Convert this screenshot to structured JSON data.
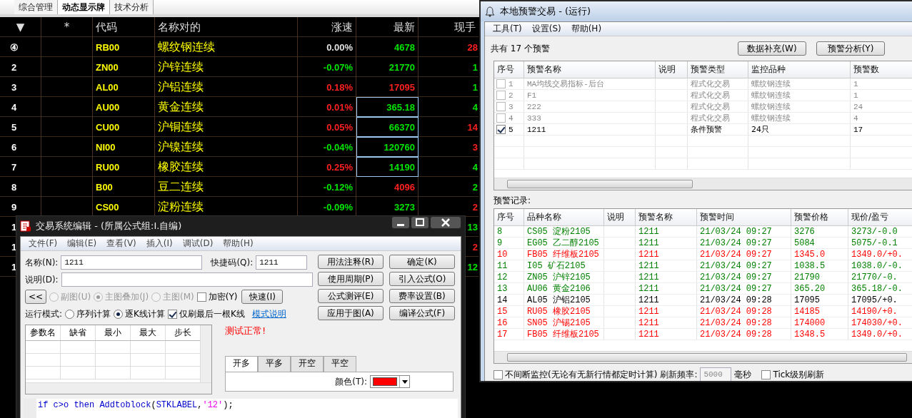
{
  "app_tabs": [
    {
      "label": "综合管理",
      "selected": false
    },
    {
      "label": "动态显示牌",
      "selected": true
    },
    {
      "label": "技术分析",
      "selected": false
    }
  ],
  "market": {
    "columns": [
      "▼",
      "*",
      "代码",
      "名称对的",
      "涨速",
      "最新",
      "现手"
    ],
    "rows": [
      {
        "num": "④",
        "code": "RB00",
        "name": "螺纹钢连续",
        "change": {
          "text": "0.00%",
          "color": "#e0e0e0"
        },
        "last": {
          "text": "4678",
          "color": "#00e600",
          "boxed": false
        },
        "volume": {
          "text": "28",
          "color": "#ff2020"
        }
      },
      {
        "num": "2",
        "code": "ZN00",
        "name": "沪锌连续",
        "change": {
          "text": "-0.07%",
          "color": "#00e600"
        },
        "last": {
          "text": "21770",
          "color": "#00e600",
          "boxed": false
        },
        "volume": {
          "text": "1",
          "color": "#00e600"
        }
      },
      {
        "num": "3",
        "code": "AL00",
        "name": "沪铝连续",
        "change": {
          "text": "0.18%",
          "color": "#ff2020"
        },
        "last": {
          "text": "17095",
          "color": "#ff2020",
          "boxed": false
        },
        "volume": {
          "text": "1",
          "color": "#00e600"
        }
      },
      {
        "num": "4",
        "code": "AU00",
        "name": "黄金连续",
        "change": {
          "text": "0.01%",
          "color": "#ff2020"
        },
        "last": {
          "text": "365.18",
          "color": "#00e600",
          "boxed": true
        },
        "volume": {
          "text": "4",
          "color": "#00e600"
        }
      },
      {
        "num": "5",
        "code": "CU00",
        "name": "沪铜连续",
        "change": {
          "text": "0.05%",
          "color": "#ff2020"
        },
        "last": {
          "text": "66370",
          "color": "#00e600",
          "boxed": true
        },
        "volume": {
          "text": "14",
          "color": "#ff2020"
        }
      },
      {
        "num": "6",
        "code": "NI00",
        "name": "沪镍连续",
        "change": {
          "text": "-0.04%",
          "color": "#00e600"
        },
        "last": {
          "text": "120760",
          "color": "#00e600",
          "boxed": true
        },
        "volume": {
          "text": "3",
          "color": "#ff2020"
        }
      },
      {
        "num": "7",
        "code": "RU00",
        "name": "橡胶连续",
        "change": {
          "text": "0.25%",
          "color": "#ff2020"
        },
        "last": {
          "text": "14190",
          "color": "#00e600",
          "boxed": true
        },
        "volume": {
          "text": "4",
          "color": "#00e600"
        }
      },
      {
        "num": "8",
        "code": "B00",
        "name": "豆二连续",
        "change": {
          "text": "-0.12%",
          "color": "#00e600"
        },
        "last": {
          "text": "4096",
          "color": "#ff2020",
          "boxed": false
        },
        "volume": {
          "text": "2",
          "color": "#00e600"
        }
      },
      {
        "num": "9",
        "code": "CS00",
        "name": "淀粉连续",
        "change": {
          "text": "-0.09%",
          "color": "#00e600"
        },
        "last": {
          "text": "3273",
          "color": "#00e600",
          "boxed": false
        },
        "volume": {
          "text": "2",
          "color": "#ff2020"
        }
      },
      {
        "num": "1",
        "volume": {
          "text": "13",
          "color": "#00e600"
        }
      },
      {
        "num": "1",
        "volume": {
          "text": "2",
          "color": "#ff2020"
        }
      },
      {
        "num": "1",
        "volume": {
          "text": "12",
          "color": "#00e600"
        }
      }
    ]
  },
  "editor": {
    "title": "交易系统编辑 - (所属公式组:I.自编)",
    "menu": [
      "文件(F)",
      "编辑(E)",
      "查看(V)",
      "插入(I)",
      "调试(D)",
      "帮助(H)"
    ],
    "name_label": "名称(N):",
    "name_value": "1211",
    "shortcut_label": "快捷码(Q):",
    "shortcut_value": "1211",
    "desc_label": "说明(D):",
    "back_button": "<<",
    "chart_options": [
      {
        "label": "副图(U)",
        "selected": false,
        "disabled": true
      },
      {
        "label": "主图叠加(J)",
        "selected": true,
        "disabled": true
      },
      {
        "label": "主图(M)",
        "selected": false,
        "disabled": true
      }
    ],
    "encrypt": {
      "label": "加密(Y)",
      "checked": false
    },
    "fast_button": "快速(I)",
    "buttons": [
      "用法注释(R)",
      "确定(K)",
      "使用周期(P)",
      "引入公式(O)",
      "公式测评(E)",
      "费率设置(B)",
      "应用于图(A)",
      "编译公式(F)"
    ],
    "run_mode_label": "运行模式:",
    "run_modes": [
      {
        "label": "序列计算",
        "selected": false
      },
      {
        "label": "逐K线计算",
        "selected": true
      }
    ],
    "last_bar_only": {
      "label": "仅刷最后一根K线",
      "checked": true
    },
    "mode_link": "模式说明",
    "param_columns": [
      "参数名",
      "缺省",
      "最小",
      "最大",
      "步长"
    ],
    "status": "测试正常!",
    "signal_tabs": [
      {
        "label": "开多",
        "selected": true
      },
      {
        "label": "平多",
        "selected": false
      },
      {
        "label": "开空",
        "selected": false
      },
      {
        "label": "平空",
        "selected": false
      }
    ],
    "color_label": "颜色(T):",
    "color": "#ff0000",
    "code": [
      {
        "kind": "keyword",
        "text": "if c>o then Addtoblock"
      },
      {
        "kind": "plain",
        "text": "("
      },
      {
        "kind": "keyword",
        "text": "STKLABEL"
      },
      {
        "kind": "plain",
        "text": ","
      },
      {
        "kind": "string",
        "text": "'12'"
      },
      {
        "kind": "plain",
        "text": ");"
      }
    ]
  },
  "alerts": {
    "title": "本地预警交易 - (运行)",
    "menu": [
      "工具(T)",
      "设置(S)",
      "帮助(H)"
    ],
    "summary": "共有 17 个预警",
    "buttons": [
      "数据补充(W)",
      "预警分析(Y)"
    ],
    "columns": [
      "序号",
      "预警名称",
      "说明",
      "预警类型",
      "监控品种",
      "预警数"
    ],
    "rows": [
      {
        "num": "1",
        "name": "MA均线交易指标-后台",
        "type": "程式化交易",
        "target": "螺纹钢连续",
        "count": "1",
        "checked": false,
        "disabled": true
      },
      {
        "num": "2",
        "name": "F1",
        "type": "程式化交易",
        "target": "螺纹钢连续",
        "count": "1",
        "checked": false,
        "disabled": true
      },
      {
        "num": "3",
        "name": "222",
        "type": "程式化交易",
        "target": "螺纹钢连续",
        "count": "24",
        "checked": false,
        "disabled": true
      },
      {
        "num": "4",
        "name": "333",
        "type": "程式化交易",
        "target": "螺纹钢连续",
        "count": "4",
        "checked": false,
        "disabled": true
      },
      {
        "num": "5",
        "name": "1211",
        "type": "条件预警",
        "target": "24只",
        "count": "17",
        "checked": true,
        "disabled": false
      }
    ],
    "records_label": "预警记录:",
    "record_columns": [
      "序号",
      "品种名称",
      "说明",
      "预警名称",
      "预警时间",
      "预警价格",
      "现价/盈亏"
    ],
    "records": [
      {
        "num": "8",
        "item": "CS05 淀粉2105",
        "alert": "1211",
        "time": "21/03/24 09:27",
        "price": "3276",
        "current": "3273/-0.0",
        "color": "#008000"
      },
      {
        "num": "9",
        "item": "EG05 乙二醇2105",
        "alert": "1211",
        "time": "21/03/24 09:27",
        "price": "5084",
        "current": "5075/-0.1",
        "color": "#008000"
      },
      {
        "num": "10",
        "item": "FB05 纤维板2105",
        "alert": "1211",
        "time": "21/03/24 09:27",
        "price": "1345.0",
        "current": "1349.0/+0.",
        "color": "#ff0000"
      },
      {
        "num": "11",
        "item": "I05 矿石2105",
        "alert": "1211",
        "time": "21/03/24 09:27",
        "price": "1038.5",
        "current": "1038.0/-0.",
        "color": "#008000"
      },
      {
        "num": "12",
        "item": "ZN05 沪锌2105",
        "alert": "1211",
        "time": "21/03/24 09:27",
        "price": "21790",
        "current": "21770/-0.",
        "color": "#008000"
      },
      {
        "num": "13",
        "item": "AU06 黄金2106",
        "alert": "1211",
        "time": "21/03/24 09:27",
        "price": "365.20",
        "current": "365.18/-0.",
        "color": "#008000"
      },
      {
        "num": "14",
        "item": "AL05 沪铝2105",
        "alert": "1211",
        "time": "21/03/24 09:28",
        "price": "17095",
        "current": "17095/+0.",
        "color": "#000000"
      },
      {
        "num": "15",
        "item": "RU05 橡胶2105",
        "alert": "1211",
        "time": "21/03/24 09:28",
        "price": "14185",
        "current": "14190/+0.",
        "color": "#ff0000"
      },
      {
        "num": "16",
        "item": "SN05 沪锡2105",
        "alert": "1211",
        "time": "21/03/24 09:28",
        "price": "174000",
        "current": "174030/+0.",
        "color": "#ff0000"
      },
      {
        "num": "17",
        "item": "FB05 纤维板2105",
        "alert": "1211",
        "time": "21/03/24 09:28",
        "price": "1348.5",
        "current": "1349.0/+0.",
        "color": "#ff0000"
      }
    ],
    "continuous": {
      "label": "不间断监控(无论有无新行情都定时计算)",
      "checked": false
    },
    "refresh_label": "刷新频率:",
    "refresh_value": "5000",
    "refresh_unit": "毫秒",
    "tick_refresh": {
      "label": "Tick级别刷新",
      "checked": false
    }
  }
}
